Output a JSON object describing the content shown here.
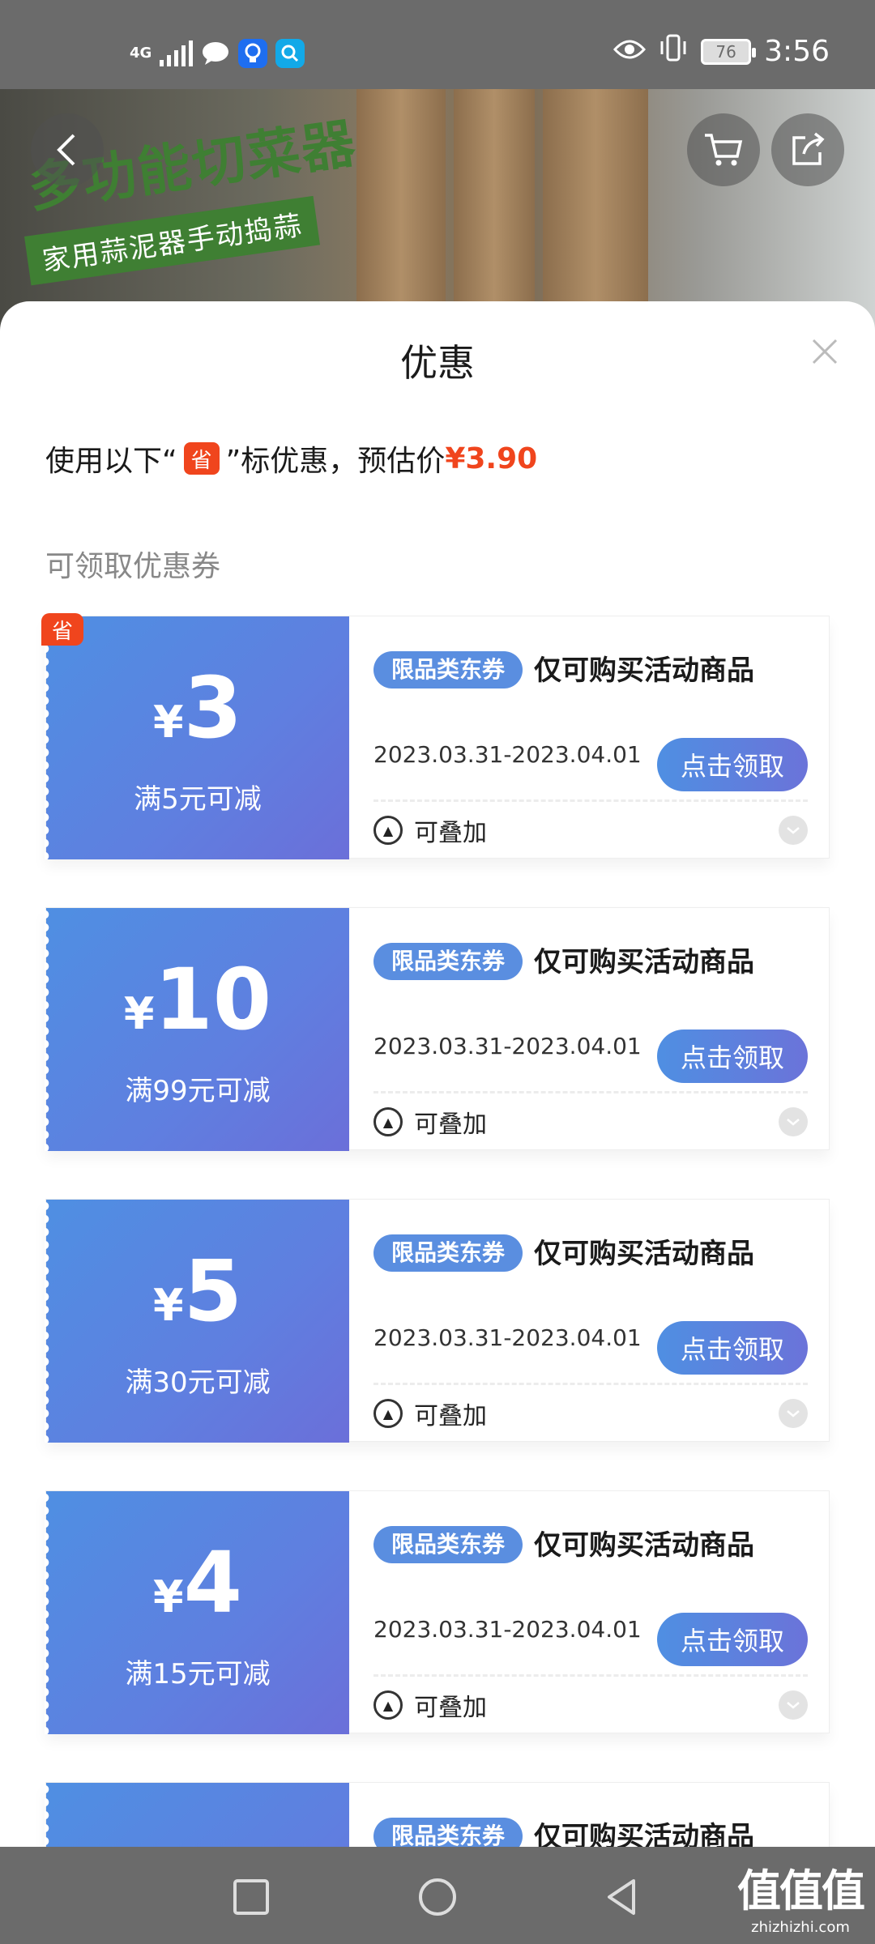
{
  "status_bar": {
    "network": "4G",
    "time": "3:56",
    "battery": "76",
    "icons": [
      "signal-icon",
      "chat-icon",
      "lightbulb-icon",
      "search-app-icon",
      "eye-icon",
      "vibrate-icon",
      "battery-icon"
    ]
  },
  "banner": {
    "title": "多功能切菜器",
    "subtitle": "家用蒜泥器手动捣蒜",
    "icons": [
      "back-icon",
      "cart-icon",
      "share-icon"
    ]
  },
  "sheet": {
    "title": "优惠",
    "estimate": {
      "prefix": "使用以下“",
      "badge": "省",
      "suffix": "”标优惠，预估价",
      "price": "¥3.90"
    },
    "section_label": "可领取优惠券"
  },
  "coupons": [
    {
      "corner_badge": "省",
      "currency": "¥",
      "amount": "3",
      "threshold": "满5元可减",
      "tag": "限品类东券",
      "description": "仅可购买活动商品",
      "date_range": "2023.03.31-2023.04.01",
      "button": "点击领取",
      "stack_label": "可叠加"
    },
    {
      "currency": "¥",
      "amount": "10",
      "threshold": "满99元可减",
      "tag": "限品类东券",
      "description": "仅可购买活动商品",
      "date_range": "2023.03.31-2023.04.01",
      "button": "点击领取",
      "stack_label": "可叠加"
    },
    {
      "currency": "¥",
      "amount": "5",
      "threshold": "满30元可减",
      "tag": "限品类东券",
      "description": "仅可购买活动商品",
      "date_range": "2023.03.31-2023.04.01",
      "button": "点击领取",
      "stack_label": "可叠加"
    },
    {
      "currency": "¥",
      "amount": "4",
      "threshold": "满15元可减",
      "tag": "限品类东券",
      "description": "仅可购买活动商品",
      "date_range": "2023.03.31-2023.04.01",
      "button": "点击领取",
      "stack_label": "可叠加"
    },
    {
      "tag": "限品类东券",
      "description": "仅可购买活动商品"
    }
  ],
  "nav_bar": {
    "icons": [
      "recents-icon",
      "home-icon",
      "back-nav-icon"
    ],
    "watermark": "值值值",
    "watermark_url": "zhizhizhi.com"
  },
  "colors": {
    "accent_red": "#f0451d",
    "coupon_blue": "#5a8ee0",
    "coupon_purple": "#6b6fd9"
  }
}
